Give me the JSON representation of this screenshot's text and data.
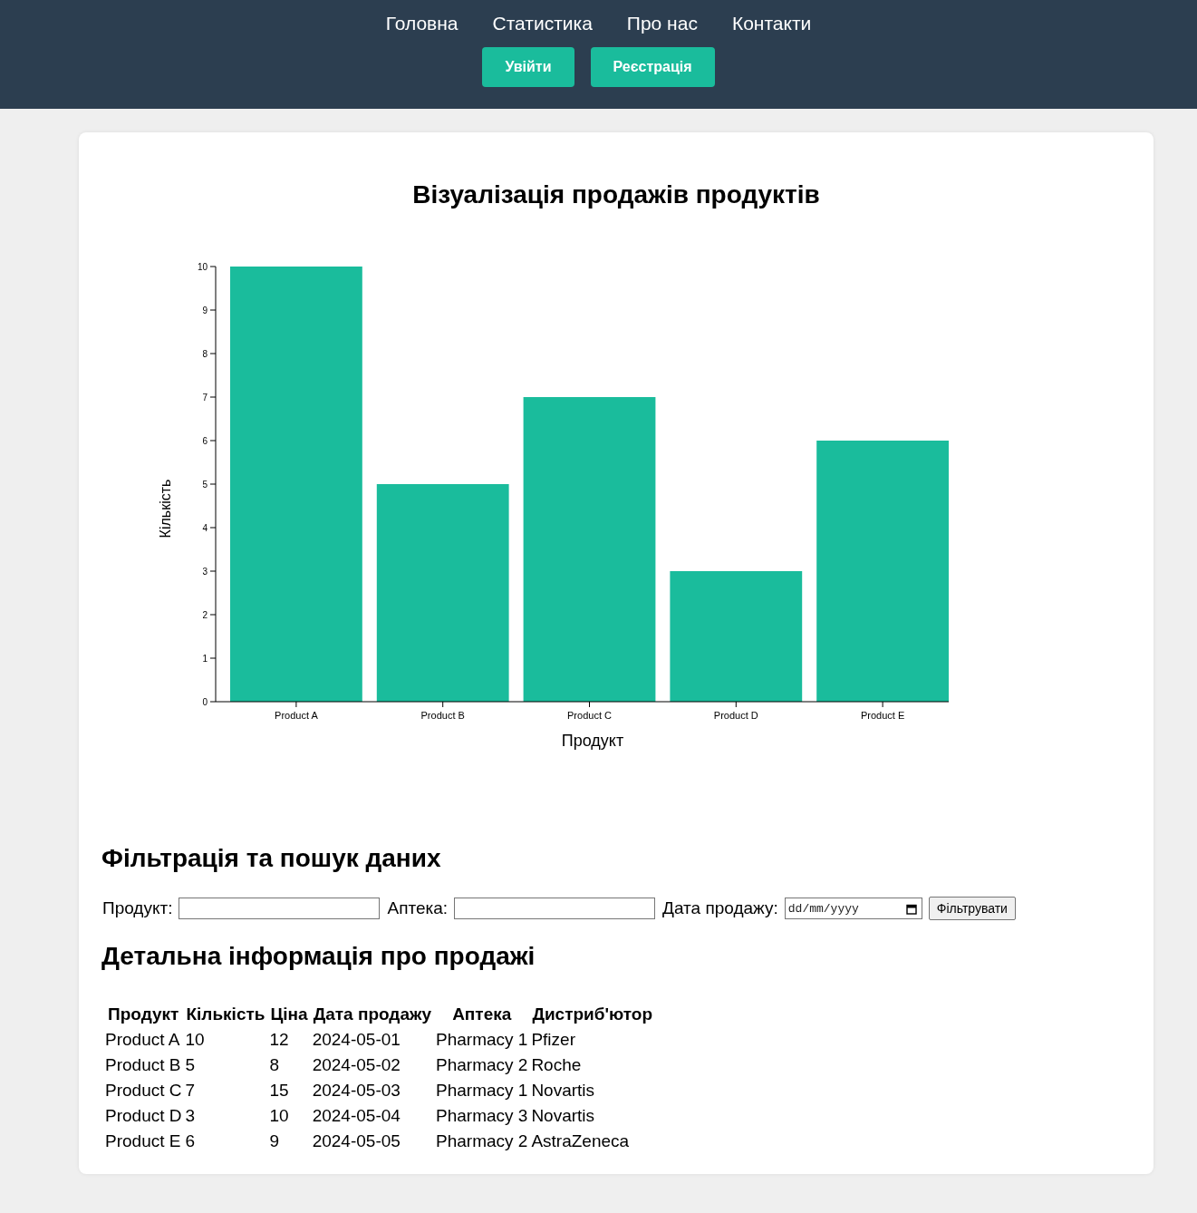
{
  "nav": {
    "links": [
      "Головна",
      "Статистика",
      "Про нас",
      "Контакти"
    ],
    "buttons": [
      "Увійти",
      "Реєстрація"
    ]
  },
  "chart_section": {
    "title": "Візуалізація продажів продуктів",
    "chart_data": {
      "type": "bar",
      "xlabel": "Продукт",
      "ylabel": "Кількість",
      "categories": [
        "Product A",
        "Product B",
        "Product C",
        "Product D",
        "Product E"
      ],
      "series": [
        {
          "color": "#1abc9c",
          "values": [
            10,
            5,
            7,
            3,
            6
          ]
        }
      ],
      "ylim": [
        0,
        10
      ],
      "yticks": [
        0,
        1,
        2,
        3,
        4,
        5,
        6,
        7,
        8,
        9,
        10
      ]
    }
  },
  "filter": {
    "title": "Фільтрація та пошук даних",
    "fields": [
      {
        "kind": "text",
        "label": "Продукт:"
      },
      {
        "kind": "text",
        "label": "Аптека:"
      },
      {
        "kind": "date",
        "label": "Дата продажу:",
        "placeholder": "dd/mm/yyyy"
      }
    ],
    "button": "Фільтрувати"
  },
  "table": {
    "title": "Детальна інформація про продажі",
    "columns": [
      "Продукт",
      "Кількість",
      "Ціна",
      "Дата продажу",
      "Аптека",
      "Дистриб'ютор"
    ],
    "rows": [
      [
        "Product A",
        "10",
        "12",
        "2024-05-01",
        "Pharmacy 1",
        "Pfizer"
      ],
      [
        "Product B",
        "5",
        "8",
        "2024-05-02",
        "Pharmacy 2",
        "Roche"
      ],
      [
        "Product C",
        "7",
        "15",
        "2024-05-03",
        "Pharmacy 1",
        "Novartis"
      ],
      [
        "Product D",
        "3",
        "10",
        "2024-05-04",
        "Pharmacy 3",
        "Novartis"
      ],
      [
        "Product E",
        "6",
        "9",
        "2024-05-05",
        "Pharmacy 2",
        "AstraZeneca"
      ]
    ]
  }
}
